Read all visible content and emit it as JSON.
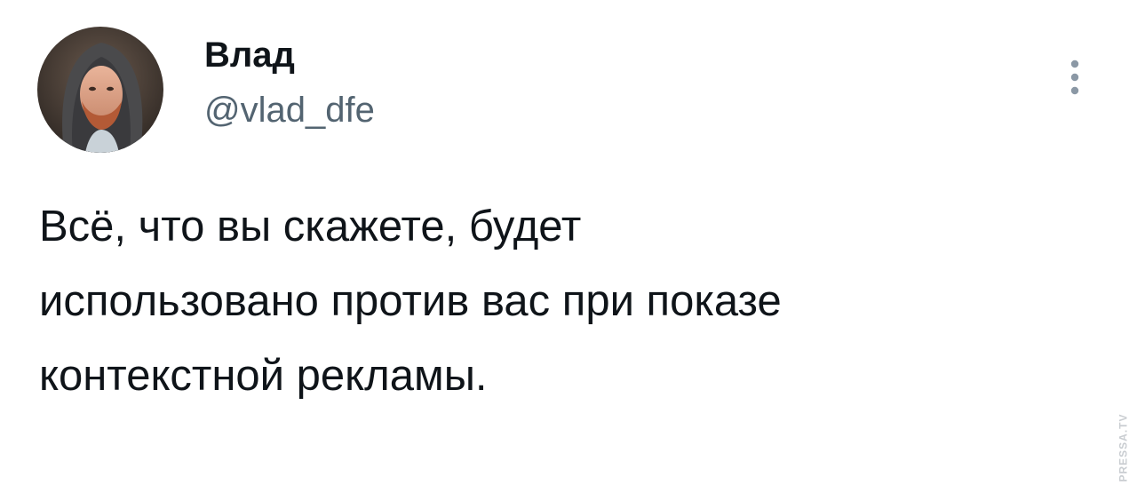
{
  "author": {
    "display_name": "Влад",
    "handle": "@vlad_dfe",
    "avatar": "profile-photo"
  },
  "tweet": {
    "text": "Всё, что вы скажете, будет\nиспользовано против вас при показе\nконтекстной рекламы."
  },
  "actions": {
    "more_icon": "more-vertical-icon"
  },
  "watermark": {
    "text": "PRESSA.TV"
  },
  "colors": {
    "text_primary": "#0f1419",
    "text_secondary": "#536471",
    "icon_muted": "#8b98a5",
    "background": "#ffffff"
  }
}
